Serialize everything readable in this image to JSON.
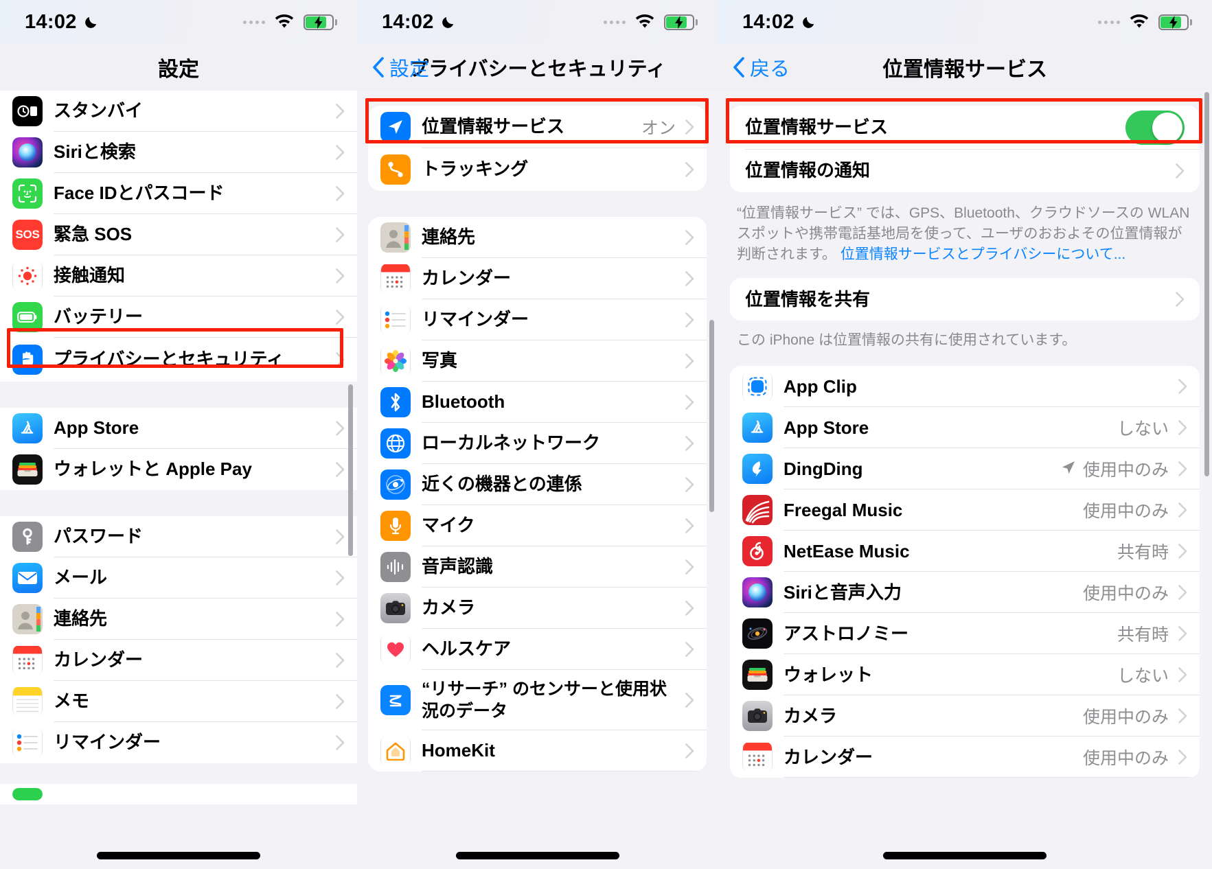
{
  "status_bar": {
    "time": "14:02",
    "moon_icon": "crescent-moon",
    "signal_dots": 4,
    "wifi_icon": "wifi",
    "battery_icon": "battery-charging"
  },
  "panel1": {
    "nav": {
      "title": "設定"
    },
    "groups": [
      {
        "items": [
          {
            "label": "スタンバイ",
            "icon": "standby-icon"
          },
          {
            "label": "Siriと検索",
            "icon": "siri-icon"
          },
          {
            "label": "Face IDとパスコード",
            "icon": "faceid-icon"
          },
          {
            "label": "緊急 SOS",
            "icon": "sos-icon"
          },
          {
            "label": "接触通知",
            "icon": "exposure-notification-icon"
          },
          {
            "label": "バッテリー",
            "icon": "battery-icon"
          },
          {
            "label": "プライバシーとセキュリティ",
            "icon": "privacy-hand-icon",
            "highlighted": true
          }
        ]
      },
      {
        "items": [
          {
            "label": "App Store",
            "icon": "appstore-icon"
          },
          {
            "label": "ウォレットと Apple Pay",
            "icon": "wallet-icon"
          }
        ]
      },
      {
        "items": [
          {
            "label": "パスワード",
            "icon": "passwords-key-icon"
          },
          {
            "label": "メール",
            "icon": "mail-icon"
          },
          {
            "label": "連絡先",
            "icon": "contacts-icon"
          },
          {
            "label": "カレンダー",
            "icon": "calendar-icon"
          },
          {
            "label": "メモ",
            "icon": "notes-icon"
          },
          {
            "label": "リマインダー",
            "icon": "reminders-icon"
          }
        ]
      }
    ]
  },
  "panel2": {
    "nav": {
      "back_label": "設定",
      "title": "プライバシーとセキュリティ",
      "back_icon": "chevron-left-icon"
    },
    "top_group": [
      {
        "label": "位置情報サービス",
        "value": "オン",
        "icon": "location-arrow-icon",
        "highlighted": true
      },
      {
        "label": "トラッキング",
        "icon": "tracking-icon"
      }
    ],
    "app_group": [
      {
        "label": "連絡先",
        "icon": "contacts-icon"
      },
      {
        "label": "カレンダー",
        "icon": "calendar-icon"
      },
      {
        "label": "リマインダー",
        "icon": "reminders-icon"
      },
      {
        "label": "写真",
        "icon": "photos-icon"
      },
      {
        "label": "Bluetooth",
        "icon": "bluetooth-icon"
      },
      {
        "label": "ローカルネットワーク",
        "icon": "local-network-globe-icon"
      },
      {
        "label": "近くの機器との連係",
        "icon": "nearby-interactions-icon"
      },
      {
        "label": "マイク",
        "icon": "microphone-icon"
      },
      {
        "label": "音声認識",
        "icon": "speech-recognition-icon"
      },
      {
        "label": "カメラ",
        "icon": "camera-icon"
      },
      {
        "label": "ヘルスケア",
        "icon": "health-heart-icon"
      },
      {
        "label": "“リサーチ” のセンサーと使用状況のデータ",
        "icon": "research-icon",
        "two_line": true
      },
      {
        "label": "HomeKit",
        "icon": "homekit-icon"
      }
    ]
  },
  "panel3": {
    "nav": {
      "back_label": "戻る",
      "title": "位置情報サービス",
      "back_icon": "chevron-left-icon"
    },
    "top_group": [
      {
        "label": "位置情報サービス",
        "toggle": true,
        "toggle_on": true,
        "highlighted": true
      },
      {
        "label": "位置情報の通知"
      }
    ],
    "description": "“位置情報サービス” では、GPS、Bluetooth、クラウドソースの WLAN スポットや携帯電話基地局を使って、ユーザのおおよその位置情報が判断されます。",
    "description_link": "位置情報サービスとプライバシーについて...",
    "share_group": [
      {
        "label": "位置情報を共有"
      }
    ],
    "share_footnote": "この iPhone は位置情報の共有に使用されています。",
    "apps": [
      {
        "label": "App Clip",
        "value": "",
        "icon": "appclip-icon"
      },
      {
        "label": "App Store",
        "value": "しない",
        "icon": "appstore-icon"
      },
      {
        "label": "DingDing",
        "value": "使用中のみ",
        "icon": "dingding-icon",
        "arrow": true
      },
      {
        "label": "Freegal Music",
        "value": "使用中のみ",
        "icon": "freegal-icon"
      },
      {
        "label": "NetEase Music",
        "value": "共有時",
        "icon": "netease-icon"
      },
      {
        "label": "Siriと音声入力",
        "value": "使用中のみ",
        "icon": "siri-icon"
      },
      {
        "label": "アストロノミー",
        "value": "共有時",
        "icon": "astronomy-icon"
      },
      {
        "label": "ウォレット",
        "value": "しない",
        "icon": "wallet-icon"
      },
      {
        "label": "カメラ",
        "value": "使用中のみ",
        "icon": "camera-icon"
      },
      {
        "label": "カレンダー",
        "value": "使用中のみ",
        "icon": "calendar-icon"
      }
    ]
  },
  "colors": {
    "highlight": "#f81f08",
    "accent": "#0a84ff",
    "toggle_on": "#34c759",
    "secondary_text": "#8e8e93"
  }
}
